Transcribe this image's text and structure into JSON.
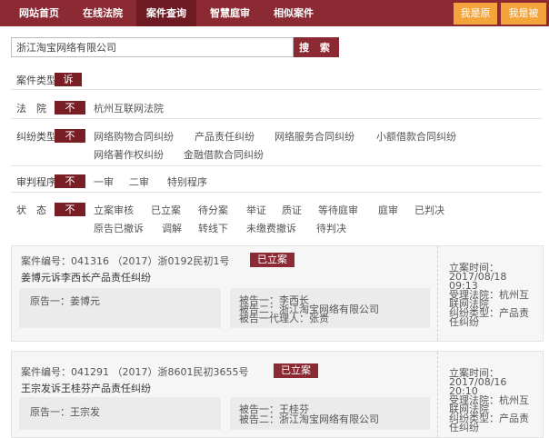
{
  "nav": {
    "items": [
      "网站首页",
      "在线法院",
      "案件查询",
      "智慧庭审",
      "相似案件"
    ],
    "active_index": 2,
    "right_buttons": [
      "我是原",
      "我是被"
    ],
    "colors": {
      "bar": "#8b2a32",
      "active": "#6e1a22",
      "orange": "#f3a53b"
    }
  },
  "search": {
    "value": "浙江淘宝网络有限公司",
    "button_label": "搜 索"
  },
  "filters": {
    "case_type": {
      "label": "案件类型",
      "selected": "诉"
    },
    "court": {
      "label": "法　院",
      "selected": "不",
      "options": [
        "杭州互联网法院"
      ]
    },
    "dispute_type": {
      "label": "纠纷类型",
      "selected": "不",
      "options_line1": [
        "网络购物合同纠纷",
        "产品责任纠纷",
        "网络服务合同纠纷",
        "小额借款合同纠纷"
      ],
      "options_line2": [
        "网络著作权纠纷",
        "金融借款合同纠纷"
      ]
    },
    "trial_procedure": {
      "label": "审判程序",
      "selected": "不",
      "options": [
        "一审",
        "二审",
        "特别程序"
      ]
    },
    "status": {
      "label": "状　态",
      "selected": "不",
      "options_line1": [
        "立案审核",
        "已立案",
        "待分案",
        "举证",
        "质证",
        "等待庭审",
        "庭审",
        "已判决"
      ],
      "options_line2": [
        "原告已撤诉",
        "调解",
        "转线下",
        "未缴费撤诉",
        "待判决"
      ]
    }
  },
  "cases": [
    {
      "case_no": "案件编号：041316 （2017）浙0192民初1号",
      "status": "已立案",
      "title": "姜博元诉李西长产品责任纠纷",
      "plaintiff": "原告一：姜博元",
      "defendants": [
        "被告一：李西长",
        "被告二：浙江淘宝网络有限公司",
        "被告一代理人：张贵"
      ],
      "side": [
        "立案时间：",
        "2017/08/18",
        "09:13",
        "受理法院：杭州互",
        "联网法院",
        "纠纷类型：产品责",
        "任纠纷"
      ]
    },
    {
      "case_no": "案件编号：041291 （2017）浙8601民初3655号",
      "status": "已立案",
      "title": "王宗发诉王桂芬产品责任纠纷",
      "plaintiff": "原告一：王宗发",
      "defendants": [
        "被告一：王桂芬",
        "被告二：浙江淘宝网络有限公司"
      ],
      "side": [
        "立案时间：",
        "2017/08/16",
        "20:10",
        "受理法院：杭州互",
        "联网法院",
        "纠纷类型：产品责",
        "任纠纷"
      ]
    }
  ]
}
